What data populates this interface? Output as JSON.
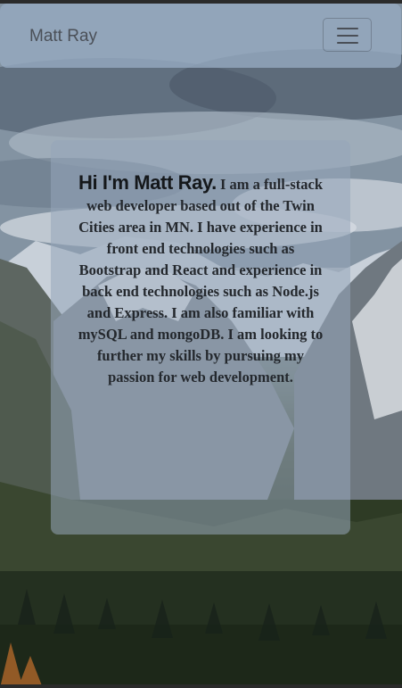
{
  "navbar": {
    "brand": "Matt Ray",
    "toggle_icon": "hamburger-menu-icon"
  },
  "about": {
    "heading": "Hi I'm Matt Ray.",
    "body": "I am a full-stack web developer based out of the Twin Cities area in MN. I have experience in front end technologies such as Bootstrap and React and experience in back end technologies such as Node.js and Express. I am also familiar with mySQL and mongoDB. I am looking to further my skills by pursuing my passion for web development."
  },
  "colors": {
    "navbar_bg": "#96aac0",
    "card_bg": "#96a5b9",
    "text": "#24282d"
  }
}
